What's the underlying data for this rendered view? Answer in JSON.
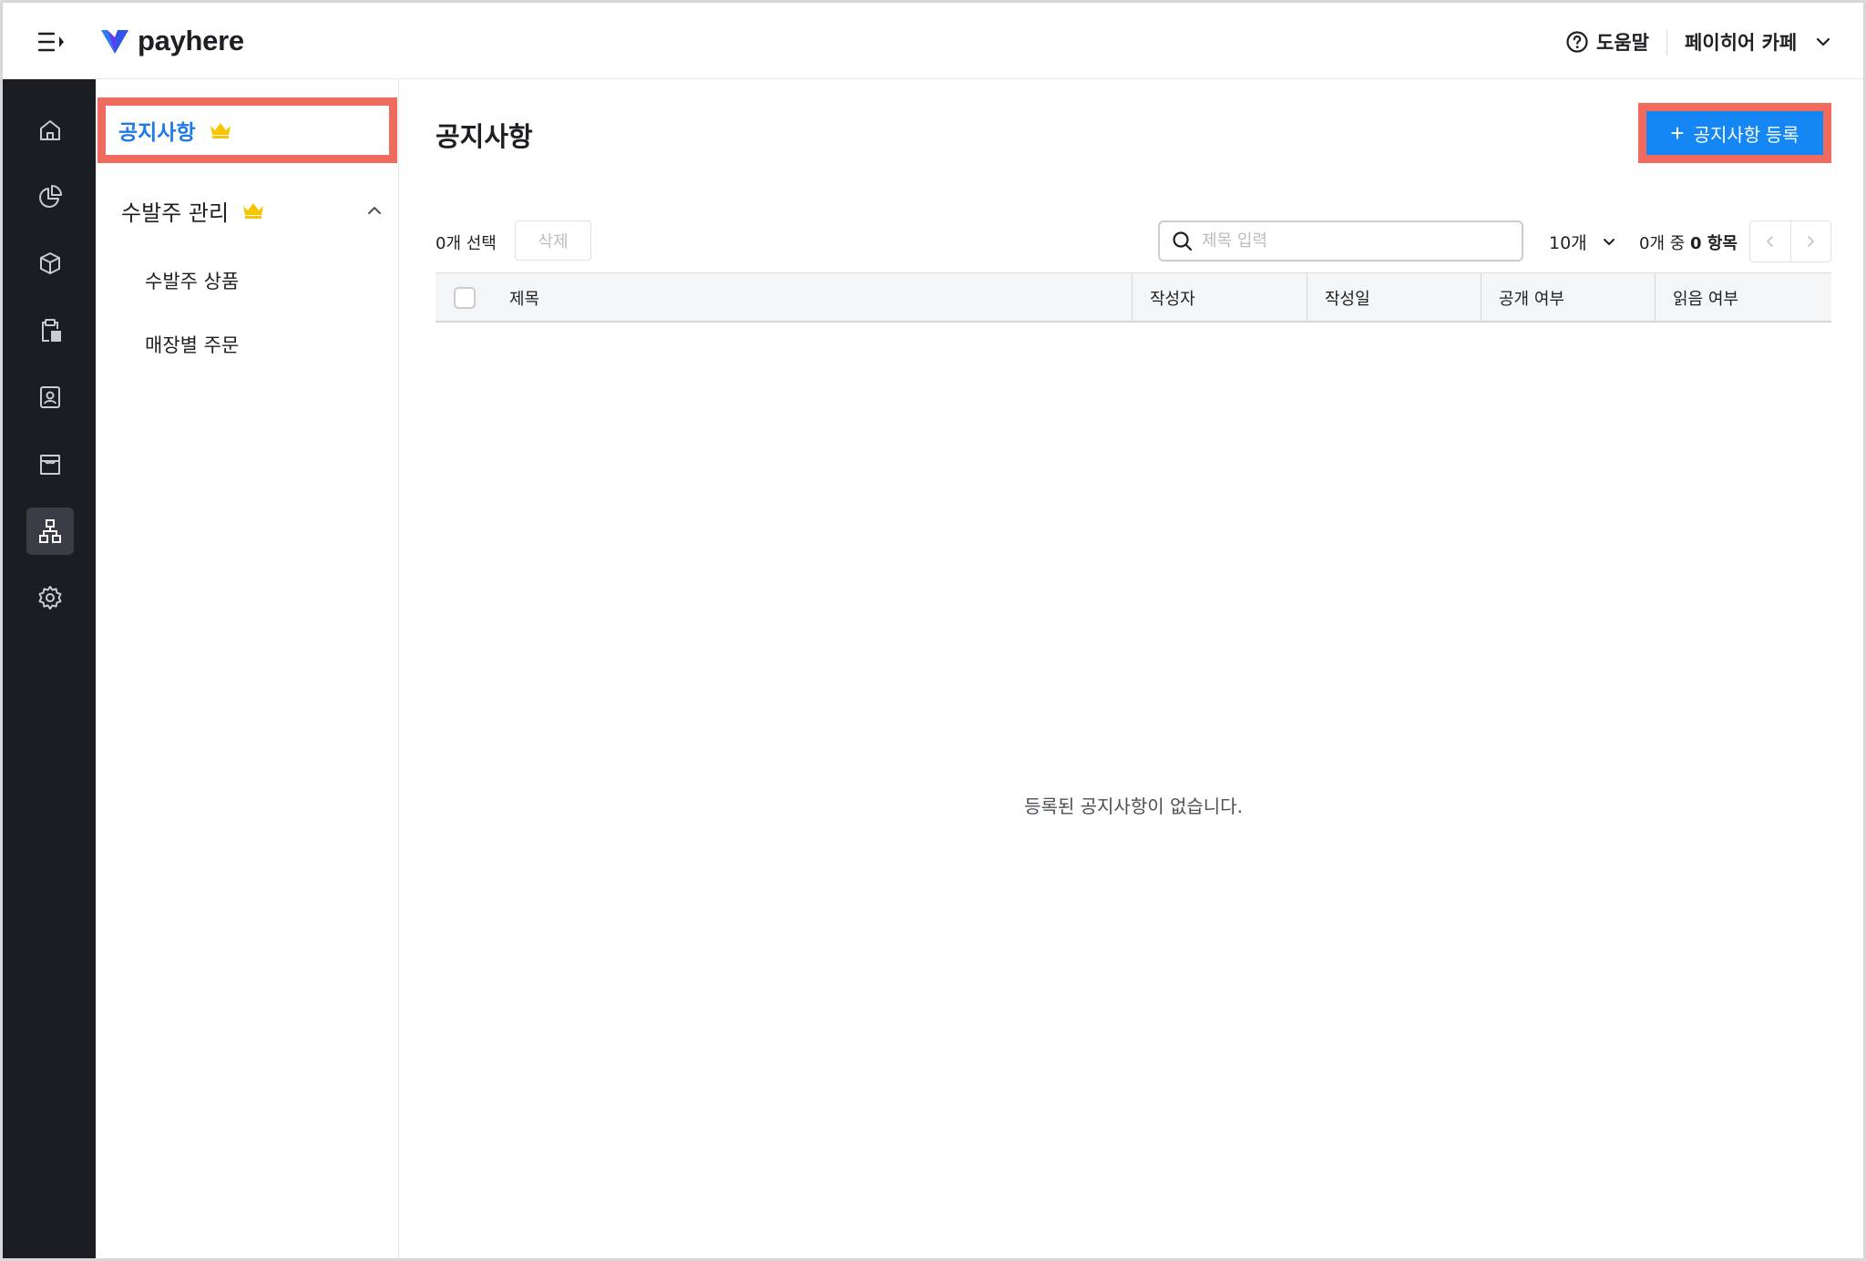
{
  "brand": {
    "name": "payhere",
    "accent": "#1487f5",
    "rail_bg": "#1b1d23",
    "highlight": "#f06a5d",
    "crown": "#f7c600"
  },
  "header": {
    "help_label": "도움말",
    "store_label": "페이히어 카페"
  },
  "rail": {
    "items": [
      {
        "icon": "home-icon"
      },
      {
        "icon": "pie-chart-icon"
      },
      {
        "icon": "box-icon"
      },
      {
        "icon": "clipboard-icon"
      },
      {
        "icon": "contact-card-icon"
      },
      {
        "icon": "store-icon"
      },
      {
        "icon": "sitemap-icon",
        "active": true
      },
      {
        "icon": "gear-icon"
      }
    ]
  },
  "submenu": {
    "active_label": "공지사항",
    "group_label": "수발주 관리",
    "children": [
      "수발주 상품",
      "매장별 주문"
    ]
  },
  "main": {
    "title": "공지사항",
    "add_button_label": "공지사항 등록",
    "selected_text": "0개 선택",
    "delete_label": "삭제",
    "search_placeholder": "제목 입력",
    "page_size": "10개",
    "range_prefix": "0개 중",
    "range_count": "0 항목",
    "columns": [
      "제목",
      "작성자",
      "작성일",
      "공개 여부",
      "읽음 여부"
    ],
    "empty_message": "등록된 공지사항이 없습니다."
  }
}
